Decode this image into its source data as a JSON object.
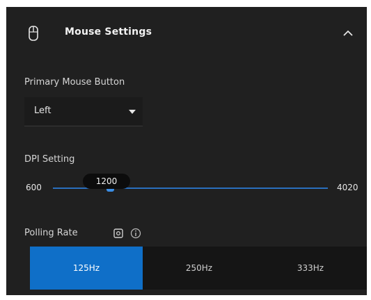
{
  "panel": {
    "title": "Mouse Settings",
    "icons": {
      "mouse": "mouse-icon",
      "collapse": "chevron-up-icon"
    }
  },
  "primary_button": {
    "label": "Primary Mouse Button",
    "selected": "Left",
    "icon": "chevron-down-icon"
  },
  "dpi": {
    "label": "DPI Setting",
    "min": "600",
    "max": "4020",
    "value": "1200",
    "value_number": 1200
  },
  "polling": {
    "label": "Polling Rate",
    "icons": [
      "settings-icon",
      "info-icon"
    ],
    "options": [
      "125Hz",
      "250Hz",
      "333Hz"
    ],
    "selected_index": 0
  },
  "colors": {
    "panel_bg": "#202020",
    "accent": "#0f6fc8",
    "track": "#2a6fbf"
  }
}
